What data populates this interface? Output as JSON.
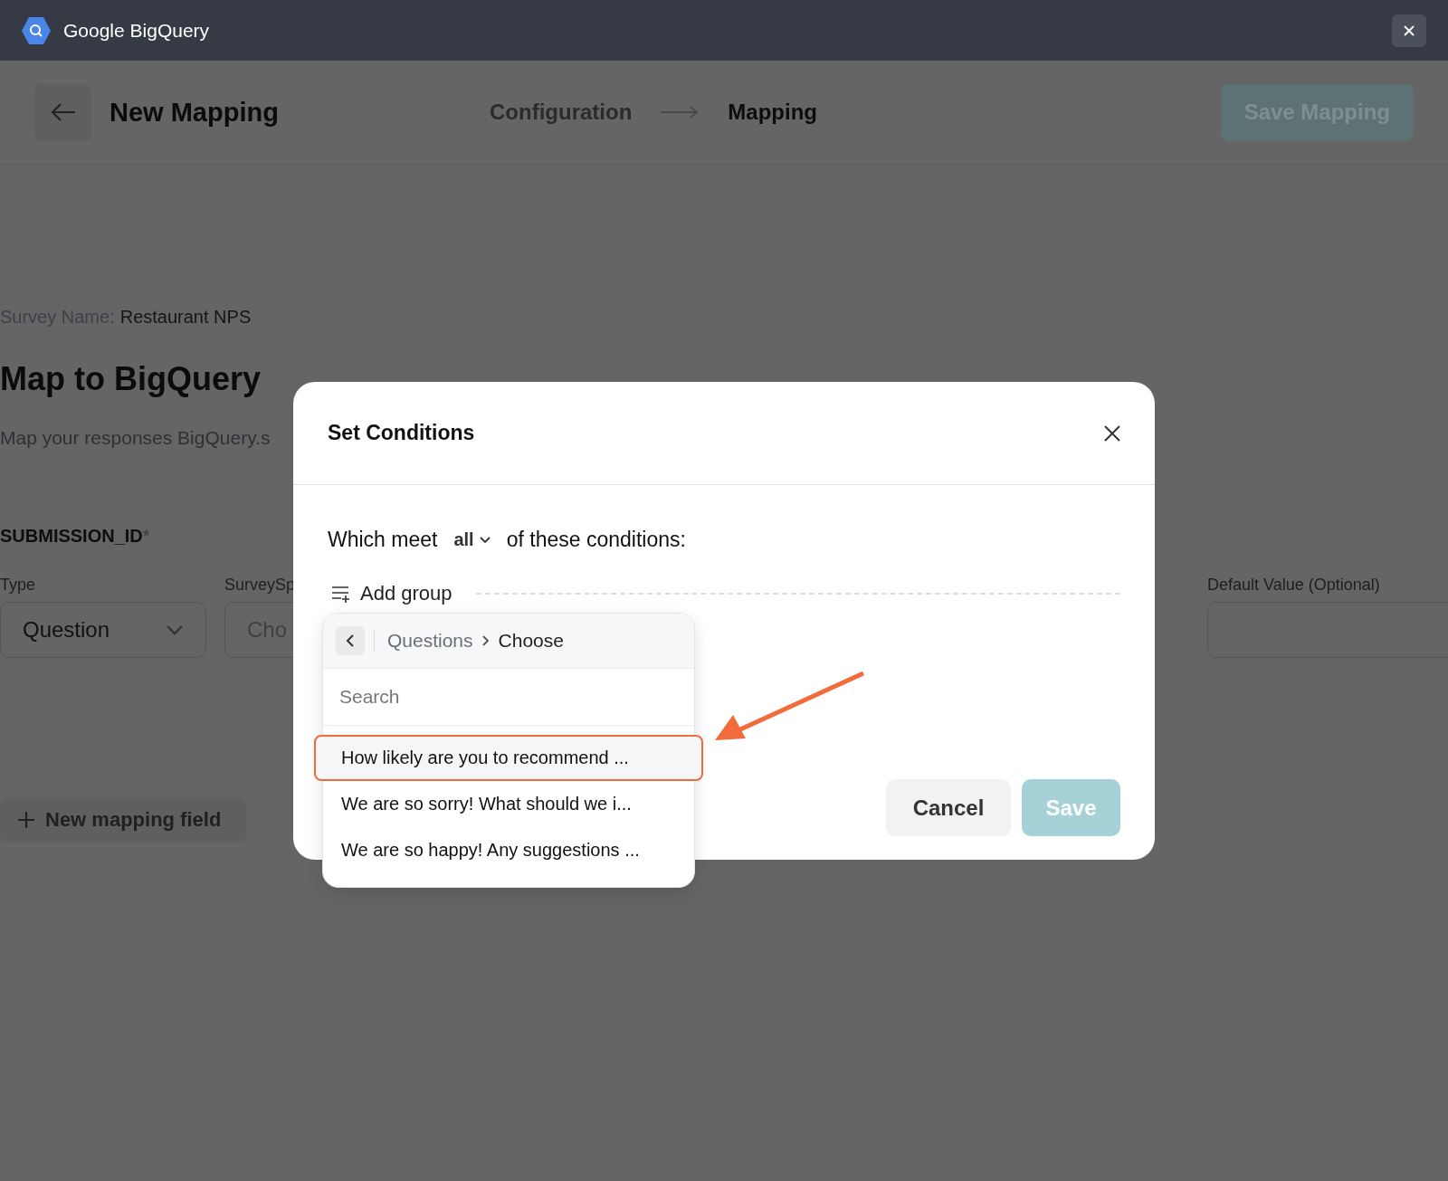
{
  "app_bar": {
    "title": "Google BigQuery"
  },
  "header": {
    "title": "New Mapping",
    "steps": [
      {
        "label": "Configuration",
        "selected": false
      },
      {
        "label": "Mapping",
        "selected": true
      }
    ],
    "save_button": "Save Mapping"
  },
  "survey": {
    "label": "Survey Name:",
    "value": "Restaurant NPS"
  },
  "heading": "Map to BigQuery",
  "subtitle": "Map your responses BigQuery.s",
  "field": {
    "name": "SUBMISSION_ID",
    "required_mark": "*",
    "type_label": "Type",
    "type_value": "Question",
    "source_label": "SurveySp",
    "source_value": "Cho",
    "default_label": "Default Value (Optional)"
  },
  "new_field_button": "New mapping field",
  "dialog": {
    "title": "Set Conditions",
    "prefix": "Which meet",
    "match": "all",
    "suffix": "of these conditions:",
    "add_group": "Add group",
    "cancel": "Cancel",
    "save": "Save"
  },
  "picker": {
    "breadcrumb": [
      "Questions",
      "Choose"
    ],
    "search_placeholder": "Search",
    "items": [
      {
        "label": "How likely are you to recommend ...",
        "selected": true
      },
      {
        "label": "We are so sorry! What should we i...",
        "selected": false
      },
      {
        "label": "We are so happy! Any suggestions ...",
        "selected": false
      }
    ]
  }
}
